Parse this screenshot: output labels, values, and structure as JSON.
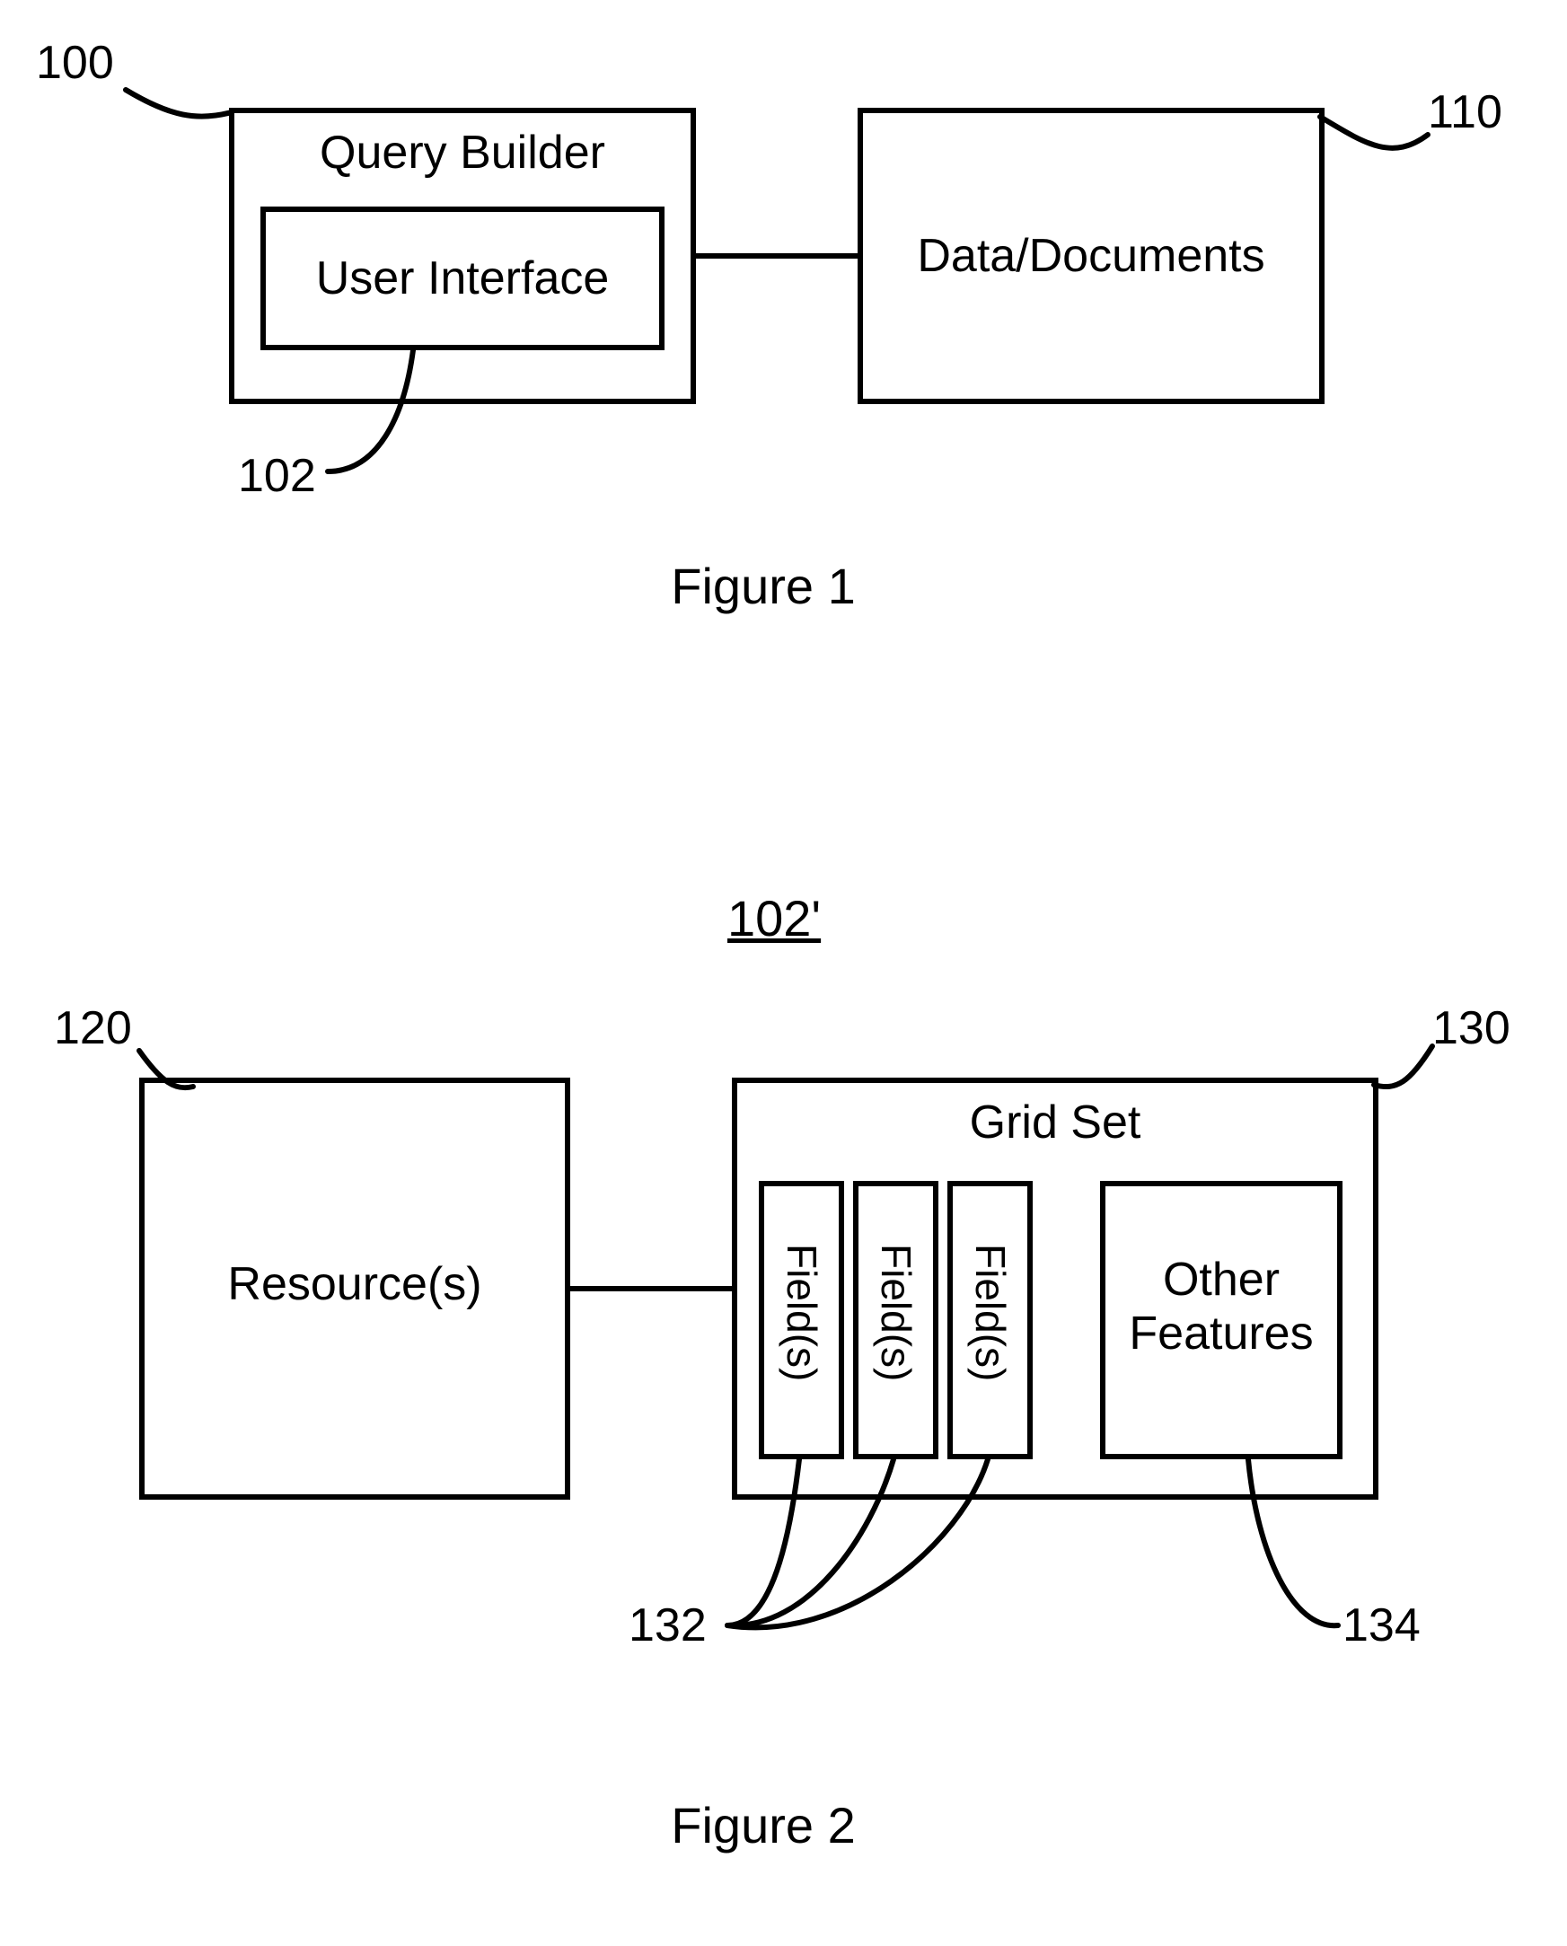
{
  "fig1": {
    "caption": "Figure 1",
    "query_builder": "Query Builder",
    "user_interface": "User Interface",
    "data_documents": "Data/Documents",
    "ref100": "100",
    "ref102": "102",
    "ref110": "110"
  },
  "midtitle": "102'",
  "fig2": {
    "caption": "Figure 2",
    "resources": "Resource(s)",
    "grid_set": "Grid Set",
    "field": "Field(s)",
    "other_features_l1": "Other",
    "other_features_l2": "Features",
    "ref120": "120",
    "ref130": "130",
    "ref132": "132",
    "ref134": "134"
  }
}
